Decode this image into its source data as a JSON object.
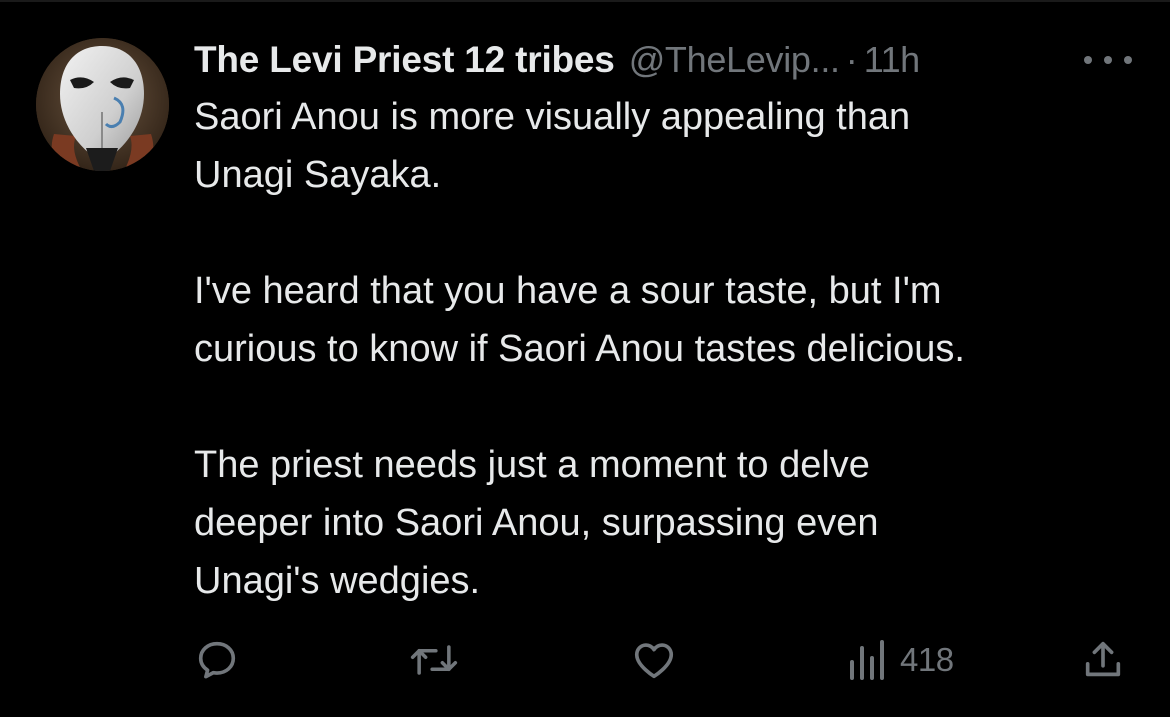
{
  "tweet": {
    "display_name": "The Levi Priest 12 tribes",
    "handle": "@TheLevip...",
    "separator": "·",
    "time": "11h",
    "avatar": "white-mask-avatar",
    "paragraphs": [
      [
        "Saori Anou is more visually appealing than",
        "Unagi Sayaka."
      ],
      [
        "I've heard that you have a sour taste, but I'm",
        "curious to know if Saori Anou tastes delicious."
      ],
      [
        "The priest needs just a moment to delve",
        "deeper into Saori Anou, surpassing even",
        "Unagi's wedgies."
      ]
    ],
    "actions": {
      "reply_icon": "reply-icon",
      "retweet_icon": "retweet-icon",
      "like_icon": "like-icon",
      "views_icon": "views-icon",
      "views_count": "418",
      "share_icon": "share-icon"
    }
  },
  "colors": {
    "background": "#000000",
    "text_primary": "#e7e9ea",
    "text_secondary": "#71767b"
  }
}
